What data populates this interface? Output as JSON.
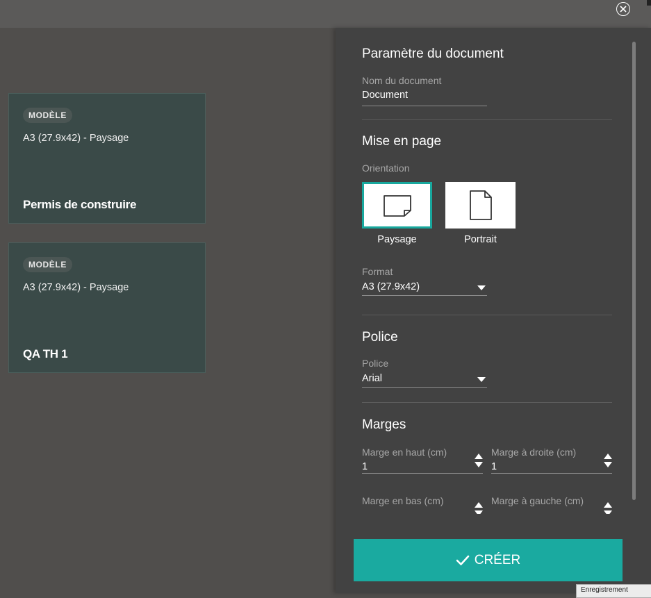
{
  "templates": [
    {
      "badge": "MODÈLE",
      "format": "A3 (27.9x42) - Paysage",
      "name": "Permis de construire"
    },
    {
      "badge": "MODÈLE",
      "format": "A3 (27.9x42) - Paysage",
      "name": "QA TH 1"
    }
  ],
  "panel": {
    "doc_section_title": "Paramètre du document",
    "doc_name_label": "Nom du document",
    "doc_name_value": "Document",
    "layout_section_title": "Mise en page",
    "orientation_label": "Orientation",
    "orientation_options": [
      "Paysage",
      "Portrait"
    ],
    "orientation_selected": "Paysage",
    "format_label": "Format",
    "format_value": "A3 (27.9x42)",
    "font_section_title": "Police",
    "font_label": "Police",
    "font_value": "Arial",
    "margins_section_title": "Marges",
    "margins": {
      "top": {
        "label": "Marge en haut (cm)",
        "value": "1"
      },
      "right": {
        "label": "Marge à droite (cm)",
        "value": "1"
      },
      "bottom": {
        "label": "Marge en bas (cm)"
      },
      "left": {
        "label": "Marge à gauche (cm)"
      }
    },
    "create_label": "CRÉER"
  },
  "tooltip": "Enregistrement",
  "colors": {
    "accent": "#1aaaa0",
    "card_bg": "#3a4a48",
    "panel_bg": "#424242",
    "page_bg": "#504e4c"
  },
  "icons": {
    "close": "close-icon",
    "landscape": "landscape-page-icon",
    "portrait": "portrait-page-icon",
    "check": "check-icon"
  }
}
